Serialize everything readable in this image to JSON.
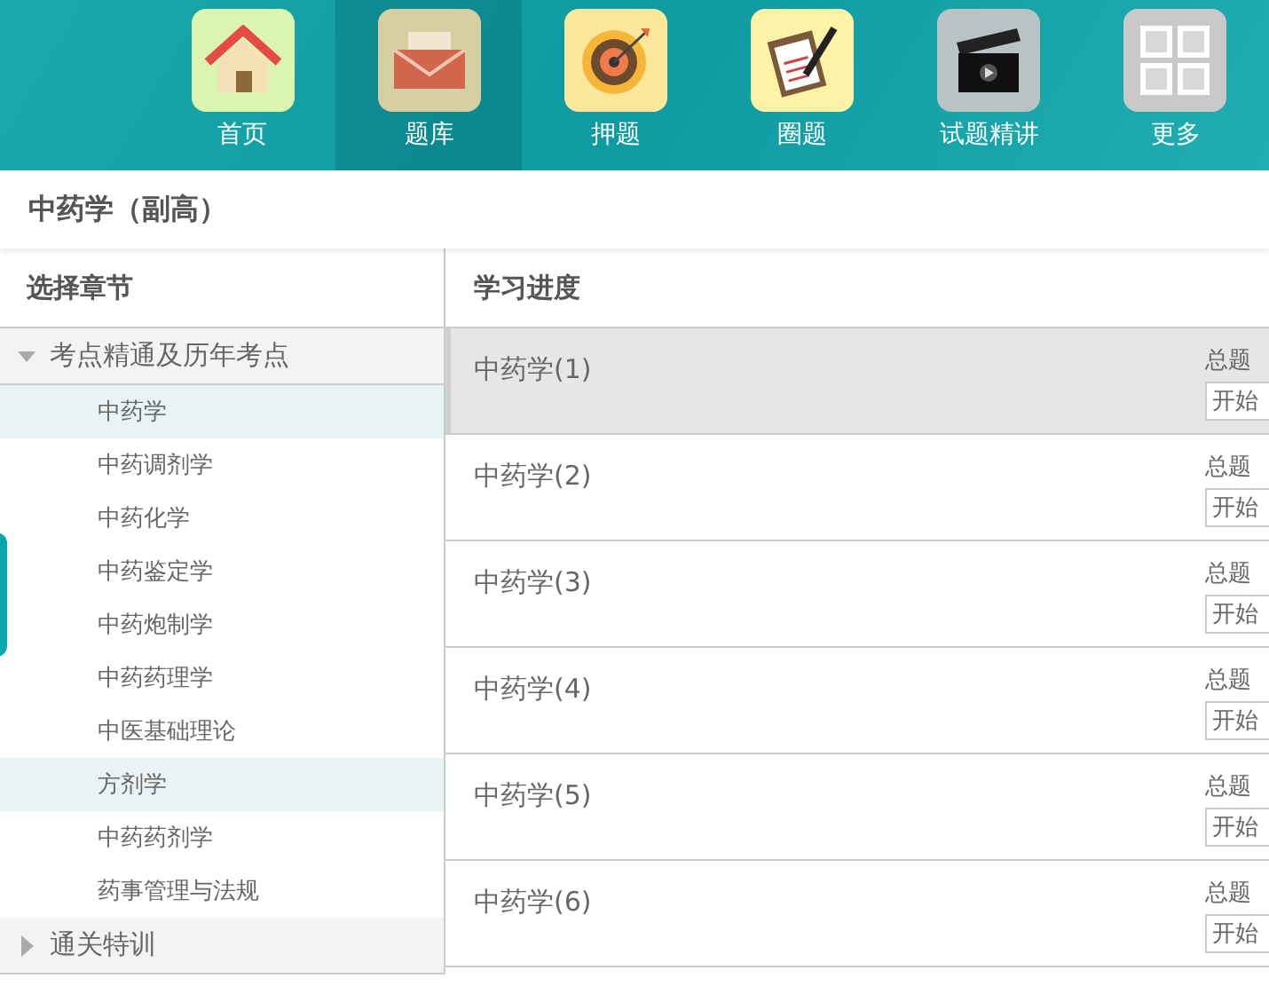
{
  "nav": [
    {
      "label": "首页",
      "kind": "house",
      "selected": false
    },
    {
      "label": "题库",
      "kind": "envelope",
      "selected": true
    },
    {
      "label": "押题",
      "kind": "target",
      "selected": false
    },
    {
      "label": "圈题",
      "kind": "clipboard",
      "selected": false
    },
    {
      "label": "试题精讲",
      "kind": "clapper",
      "selected": false
    },
    {
      "label": "更多",
      "kind": "grid",
      "selected": false
    }
  ],
  "page_title": "中药学（副高）",
  "sidebar": {
    "title": "选择章节",
    "groups": [
      {
        "label": "考点精通及历年考点",
        "expanded": true,
        "children": [
          {
            "label": "中药学",
            "selected": true
          },
          {
            "label": "中药调剂学",
            "selected": false
          },
          {
            "label": "中药化学",
            "selected": false
          },
          {
            "label": "中药鉴定学",
            "selected": false
          },
          {
            "label": "中药炮制学",
            "selected": false
          },
          {
            "label": "中药药理学",
            "selected": false
          },
          {
            "label": "中医基础理论",
            "selected": false
          },
          {
            "label": "方剂学",
            "selected": true
          },
          {
            "label": "中药药剂学",
            "selected": false
          },
          {
            "label": "药事管理与法规",
            "selected": false
          }
        ]
      },
      {
        "label": "通关特训",
        "expanded": false
      }
    ]
  },
  "progress": {
    "title": "学习进度",
    "rows": [
      {
        "name": "中药学(1)",
        "total_label": "总题",
        "button": "开始",
        "selected": true
      },
      {
        "name": "中药学(2)",
        "total_label": "总题",
        "button": "开始",
        "selected": false
      },
      {
        "name": "中药学(3)",
        "total_label": "总题",
        "button": "开始",
        "selected": false
      },
      {
        "name": "中药学(4)",
        "total_label": "总题",
        "button": "开始",
        "selected": false
      },
      {
        "name": "中药学(5)",
        "total_label": "总题",
        "button": "开始",
        "selected": false
      },
      {
        "name": "中药学(6)",
        "total_label": "总题",
        "button": "开始",
        "selected": false
      }
    ]
  }
}
